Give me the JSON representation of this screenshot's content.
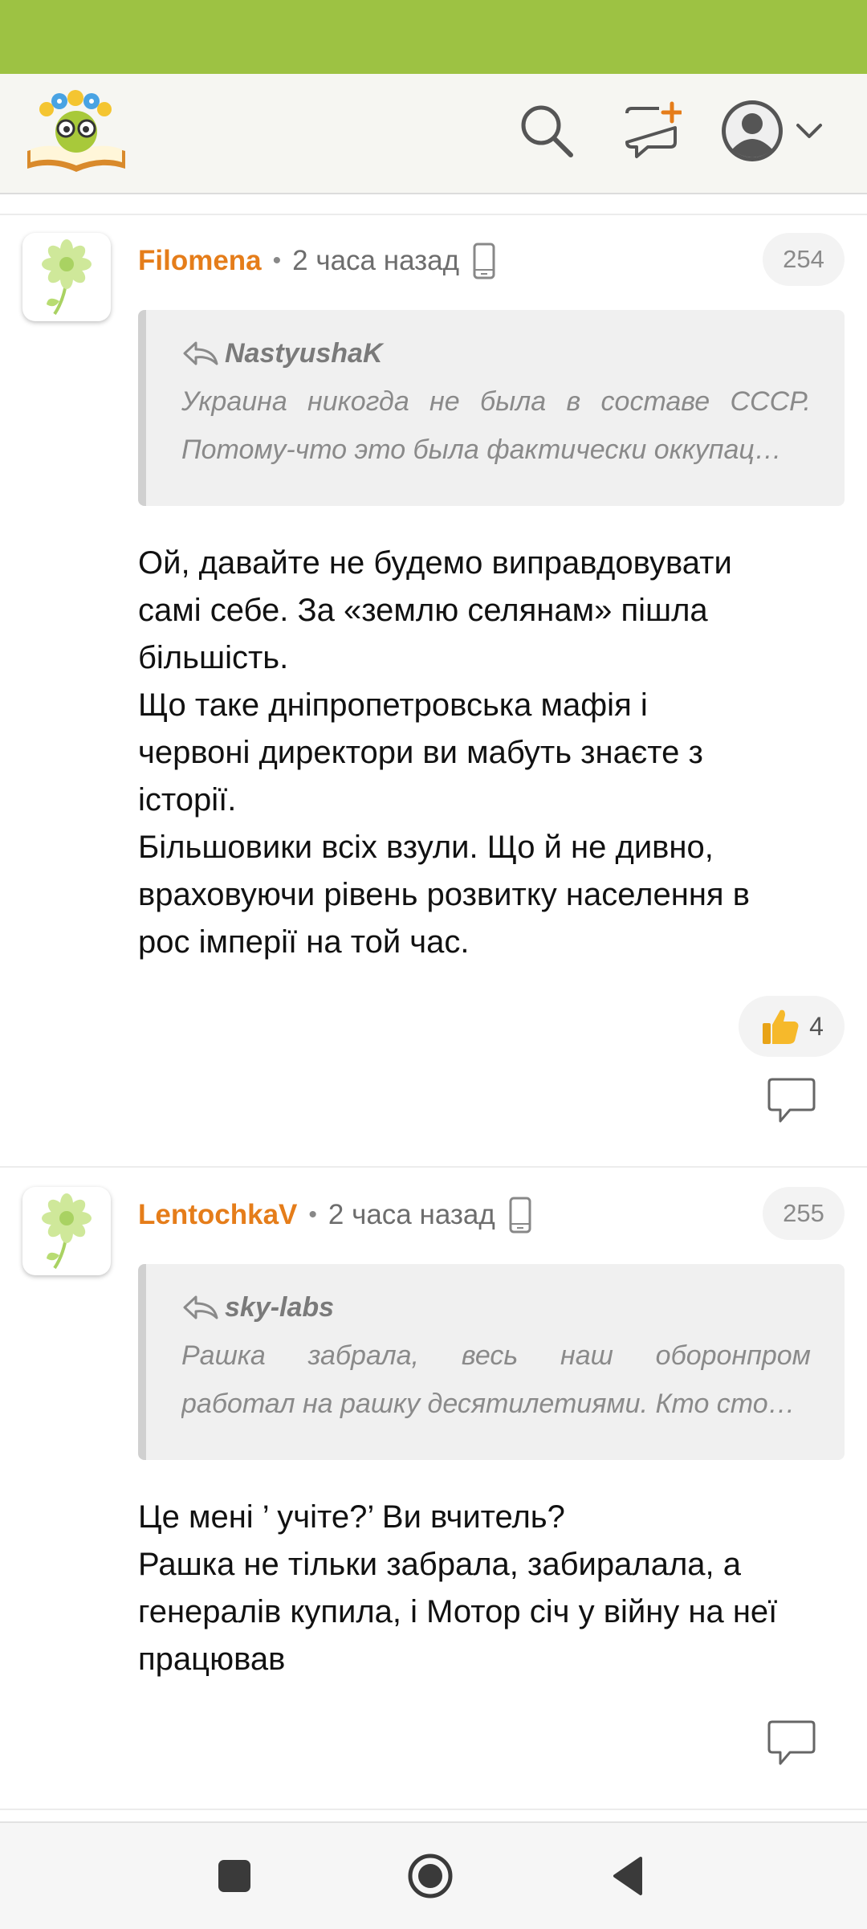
{
  "colors": {
    "status_bar": "#9dc243",
    "header_bg": "#f6f6f2",
    "author": "#e57d1a",
    "quote_bg": "#f0f0f0",
    "badge_bg": "#f3f3f3"
  },
  "header": {
    "icons": [
      "search-icon",
      "compose-icon",
      "user-icon",
      "chevron-down-icon"
    ]
  },
  "comments": [
    {
      "author": "Filomena",
      "time": "2 часа назад",
      "device": "mobile-device-icon",
      "number": "254",
      "quote": {
        "author": "NastyushaK",
        "lines": [
          "Украина никогда не была в составе СССР.",
          "Потому-что это была фактически оккупац…"
        ]
      },
      "body": [
        "Ой, давайте не будемо виправдовувати",
        "самі себе. За «землю селянам» пішла",
        "більшість.",
        "Що таке дніпропетровська мафія і",
        "червоні директори ви мабуть знаєте з",
        "історії.",
        "Більшовики всіх взули. Що й не дивно,",
        "враховуючи рівень розвитку населення в",
        "рос імперії на той час."
      ],
      "likes": "4"
    },
    {
      "author": "LentochkaV",
      "time": "2 часа назад",
      "device": "mobile-device-icon",
      "number": "255",
      "quote": {
        "author": "sky-labs",
        "lines": [
          "Рашка забрала, весь наш оборонпром",
          "работал на рашку десятилетиями. Кто сто…"
        ]
      },
      "body": [
        "Це мені ’ учіте?’ Ви вчитель?",
        "Рашка не тільки забрала, забиралала, а",
        "генералів купила, і Мотор січ у війну на неї",
        "працював"
      ]
    }
  ],
  "nav": {
    "icons": [
      "recents-square-icon",
      "home-circle-icon",
      "back-triangle-icon"
    ]
  }
}
